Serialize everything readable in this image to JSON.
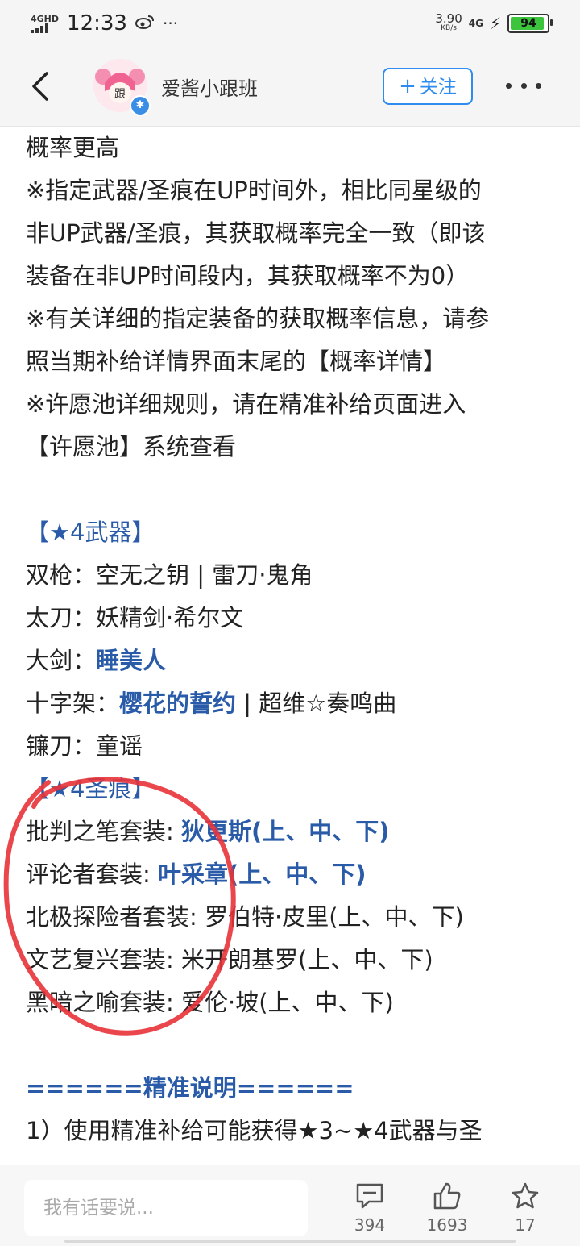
{
  "status_bar": {
    "network_label": "4GHD",
    "time": "12:33",
    "more": "···",
    "speed_value": "3.90",
    "speed_unit": "KB/s",
    "network_type": "4G",
    "battery_level": "94"
  },
  "header": {
    "author_name": "爱酱小跟班",
    "avatar_text": "跟",
    "follow_label": "关注"
  },
  "content": {
    "intro_lines": [
      "概率更高",
      "※指定武器/圣痕在UP时间外，相比同星级的",
      "非UP武器/圣痕，其获取概率完全一致（即该",
      "装备在非UP时间段内，其获取概率不为0）",
      "※有关详细的指定装备的获取概率信息，请参",
      "照当期补给详情界面末尾的【概率详情】",
      "※许愿池详细规则，请在精准补给页面进入",
      "【许愿池】系统查看"
    ],
    "weapons_header": "【★4武器】",
    "weapons": [
      {
        "label": "双枪：",
        "highlight": "",
        "rest": "空无之钥 | 雷刀·鬼角"
      },
      {
        "label": "太刀：",
        "highlight": "",
        "rest": "妖精剑·希尔文"
      },
      {
        "label": "大剑：",
        "highlight": "睡美人",
        "rest": ""
      },
      {
        "label": "十字架：",
        "highlight": "樱花的誓约",
        "rest": " | 超维☆奏鸣曲"
      },
      {
        "label": "镰刀：",
        "highlight": "",
        "rest": "童谣"
      }
    ],
    "stigmata_header": "【★4圣痕】",
    "stigmata": [
      {
        "label": "批判之笔套装: ",
        "highlight": "狄更斯(上、中、下)",
        "rest": ""
      },
      {
        "label": "评论者套装: ",
        "highlight": "叶采章(上、中、下)",
        "rest": ""
      },
      {
        "label": "北极探险者套装: ",
        "highlight": "",
        "rest": "罗伯特·皮里(上、中、下)"
      },
      {
        "label": "文艺复兴套装: ",
        "highlight": "",
        "rest": "米开朗基罗(上、中、下)"
      },
      {
        "label": "黑暗之喻套装: ",
        "highlight": "",
        "rest": "爱伦·坡(上、中、下)"
      }
    ],
    "section_header": "======精准说明======",
    "last_line": "1）使用精准补给可能获得★3~★4武器与圣"
  },
  "bottom_bar": {
    "comment_placeholder": "我有话要说...",
    "comment_count": "394",
    "like_count": "1693",
    "favorite_count": "17"
  },
  "colors": {
    "highlight_blue": "#2a5ba8",
    "follow_blue": "#2e8bf0",
    "annotation_red": "#e8333a"
  }
}
